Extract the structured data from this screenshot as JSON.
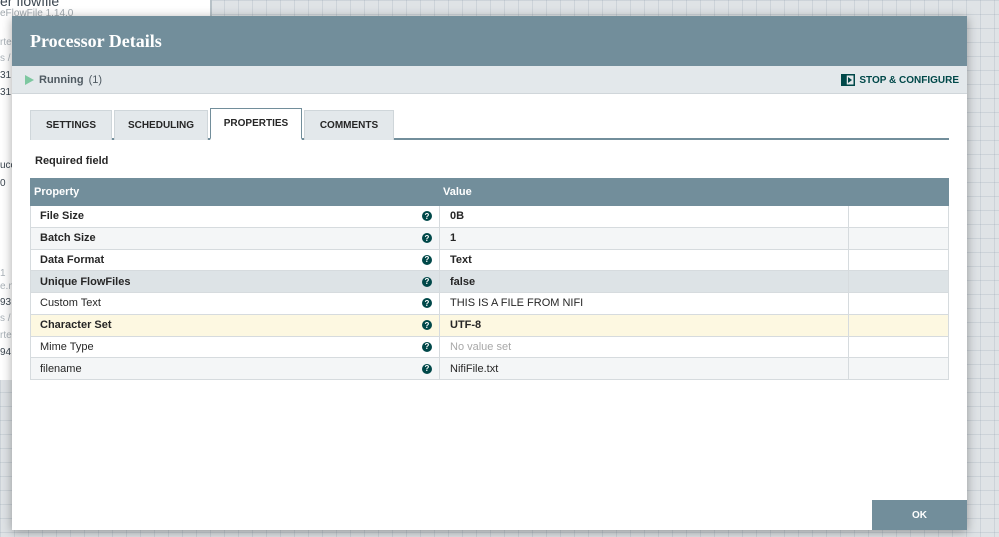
{
  "background": {
    "title": "er flowfile",
    "subtitle": "eFlowFile 1.14.0",
    "fragments": [
      "rte",
      "s /",
      "31",
      "31",
      "ucc",
      "0",
      "1",
      "e.n",
      "93",
      "s /",
      "rte",
      "94"
    ]
  },
  "dialog": {
    "title": "Processor Details",
    "status": {
      "state": "Running",
      "count": "(1)",
      "stop_configure": "STOP & CONFIGURE"
    },
    "tabs": [
      "SETTINGS",
      "SCHEDULING",
      "PROPERTIES",
      "COMMENTS"
    ],
    "active_tab": "PROPERTIES",
    "required_label": "Required field",
    "grid": {
      "header_property": "Property",
      "header_value": "Value",
      "rows": [
        {
          "property": "File Size",
          "value": "0B"
        },
        {
          "property": "Batch Size",
          "value": "1"
        },
        {
          "property": "Data Format",
          "value": "Text"
        },
        {
          "property": "Unique FlowFiles",
          "value": "false"
        },
        {
          "property": "Custom Text",
          "value": "THIS IS A FILE FROM NIFI"
        },
        {
          "property": "Character Set",
          "value": "UTF-8"
        },
        {
          "property": "Mime Type",
          "value": "No value set"
        },
        {
          "property": "filename",
          "value": "NifiFile.txt"
        }
      ],
      "help_glyph": "?"
    },
    "ok_label": "OK"
  },
  "colors": {
    "header": "#728e9b",
    "accent": "#004849",
    "running": "#7dc7a0",
    "highlight_row": "#fdf8e1"
  }
}
